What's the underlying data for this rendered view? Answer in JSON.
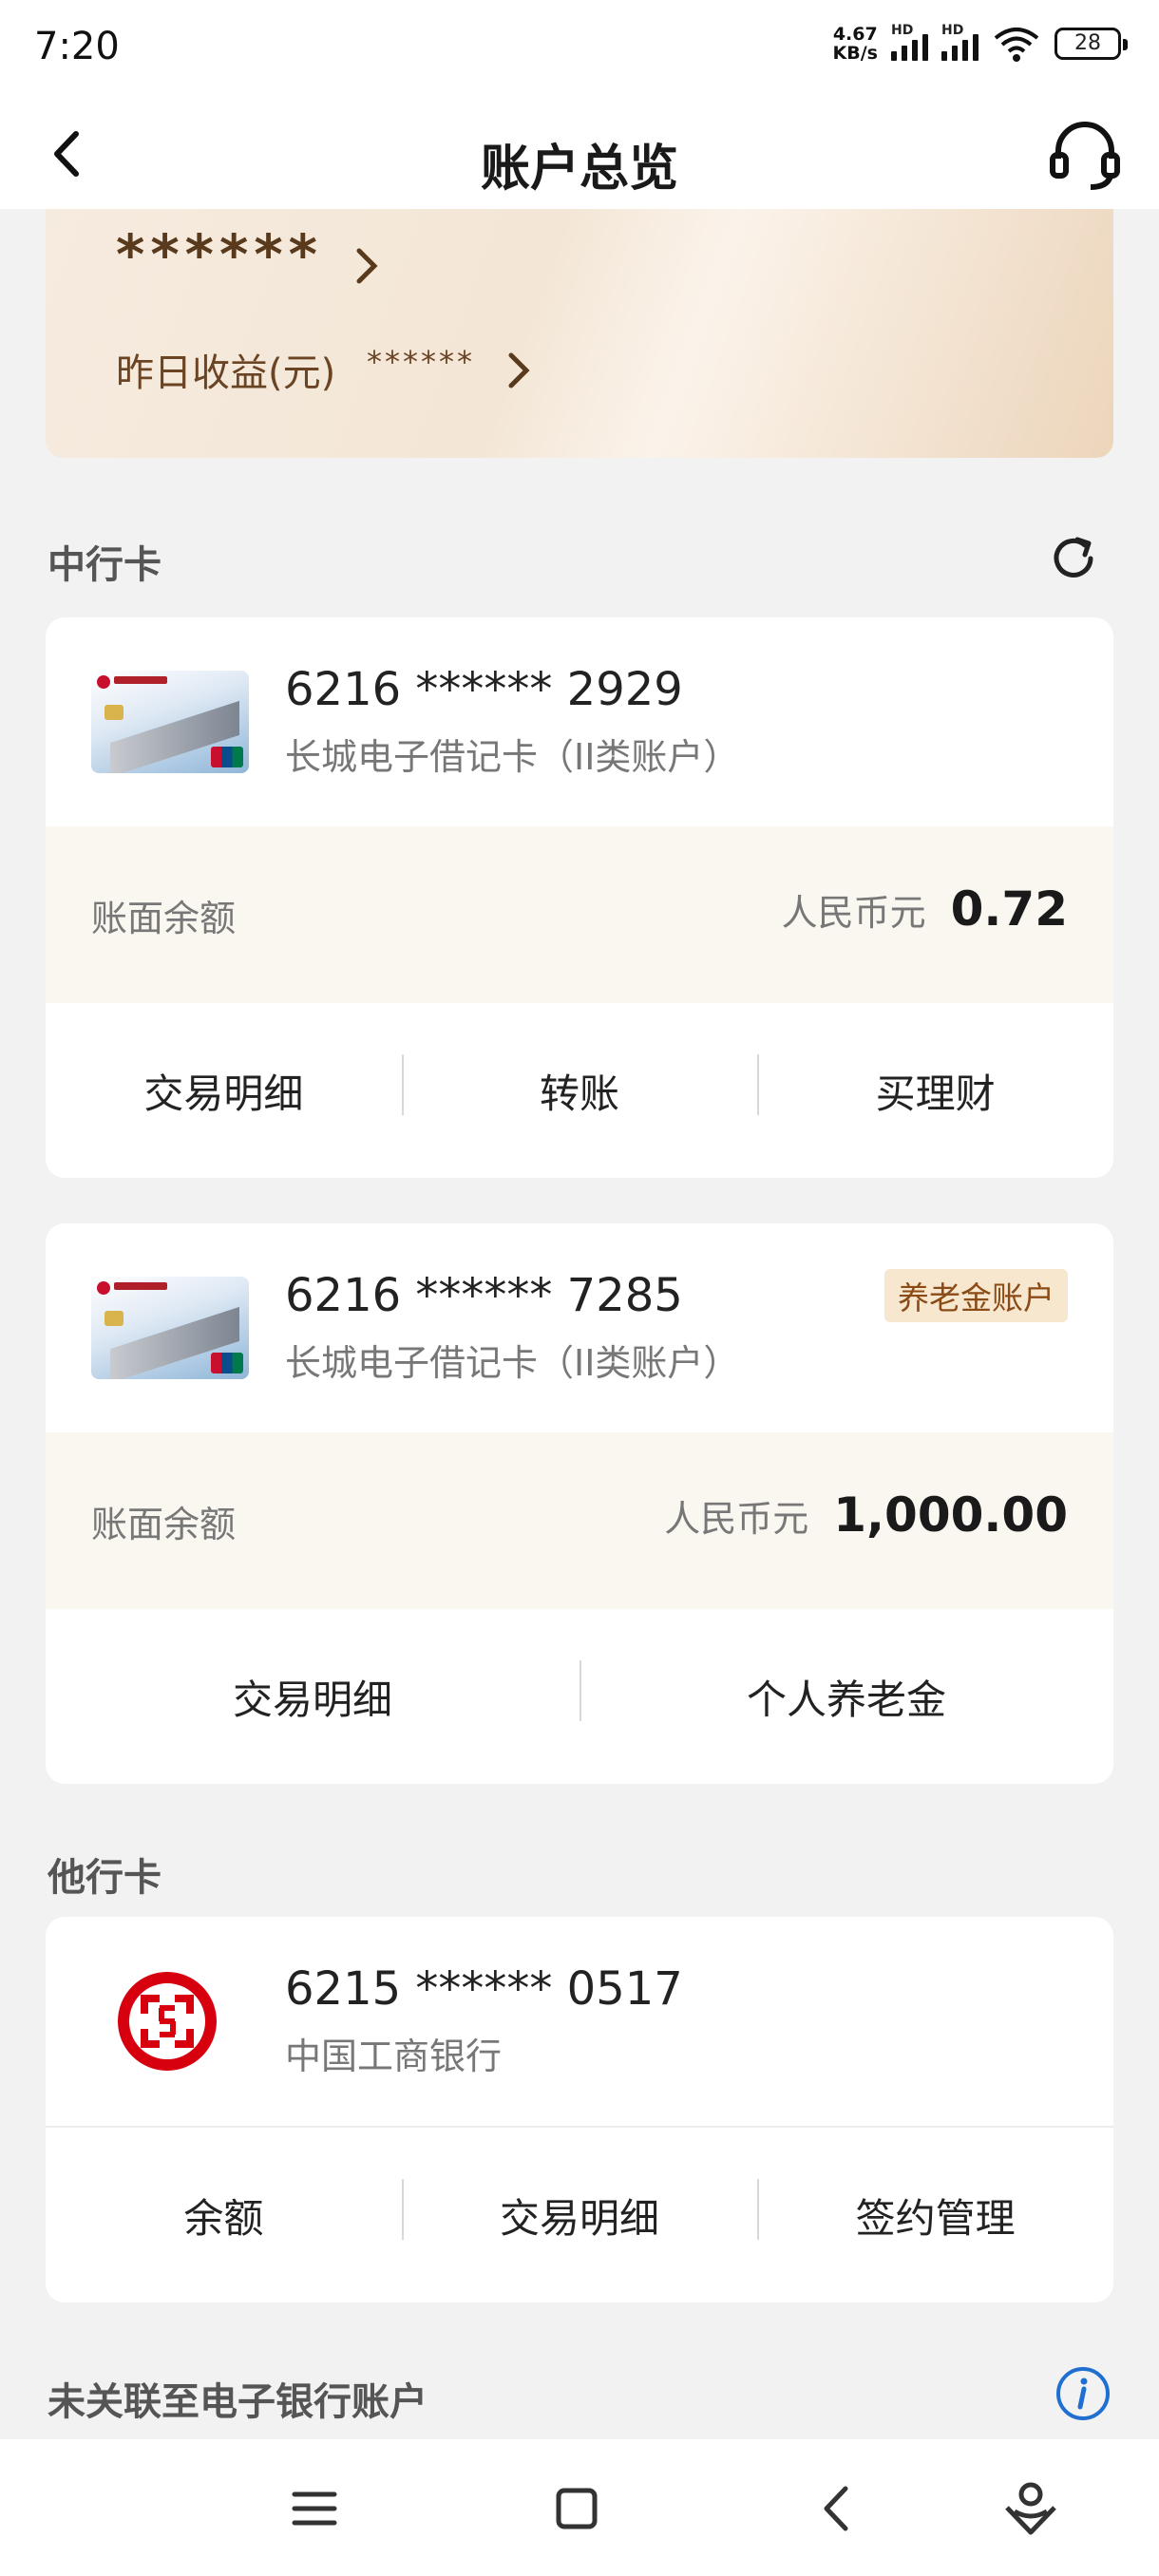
{
  "status_bar": {
    "time": "7:20",
    "net_speed_value": "4.67",
    "net_speed_unit": "KB/s",
    "hd1": "HD",
    "hd2": "HD",
    "battery": "28"
  },
  "header": {
    "title": "账户总览"
  },
  "gold_card": {
    "masked_total": "******",
    "yesterday_label": "昨日收益(元)",
    "yesterday_value": "******"
  },
  "boc_section": {
    "title": "中行卡",
    "cards": [
      {
        "number": "6216 ****** 2929",
        "type": "长城电子借记卡（II类账户）",
        "balance_label": "账面余额",
        "currency": "人民币元",
        "amount": "0.72",
        "actions": [
          "交易明细",
          "转账",
          "买理财"
        ]
      },
      {
        "number": "6216 ****** 7285",
        "type": "长城电子借记卡（II类账户）",
        "tag": "养老金账户",
        "balance_label": "账面余额",
        "currency": "人民币元",
        "amount": "1,000.00",
        "actions": [
          "交易明细",
          "个人养老金"
        ]
      }
    ]
  },
  "other_section": {
    "title": "他行卡",
    "card": {
      "number": "6215 ****** 0517",
      "bank": "中国工商银行",
      "actions": [
        "余额",
        "交易明细",
        "签约管理"
      ]
    }
  },
  "unlinked_section": {
    "title": "未关联至电子银行账户"
  },
  "colors": {
    "accent_gold": "#6b4424",
    "icbc_red": "#d7000f",
    "info_blue": "#1f6fd1",
    "tag_bg": "#f8e7cf"
  }
}
